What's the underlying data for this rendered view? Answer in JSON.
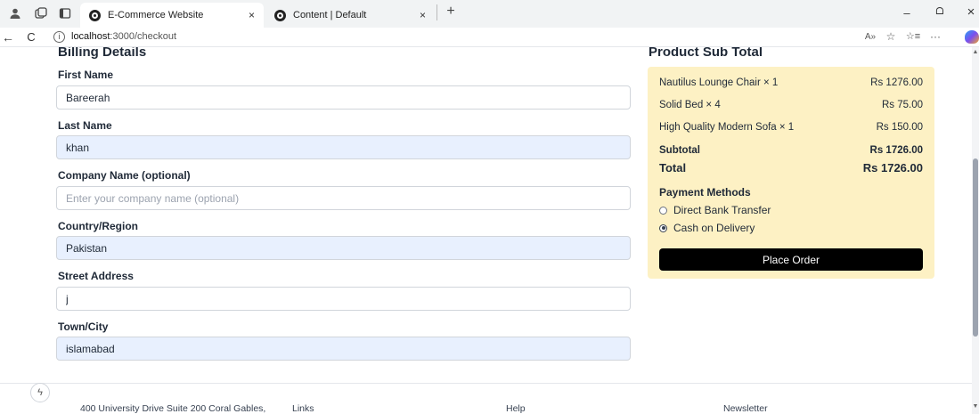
{
  "browser": {
    "tabs": [
      {
        "title": "E-Commerce Website",
        "active": true
      },
      {
        "title": "Content | Default",
        "active": false
      }
    ],
    "url_host": "localhost",
    "url_path": ":3000/checkout"
  },
  "billing": {
    "title": "Billing Details",
    "fields": [
      {
        "label": "First Name",
        "value": "Bareerah",
        "placeholder": ""
      },
      {
        "label": "Last Name",
        "value": "khan",
        "placeholder": ""
      },
      {
        "label": "Company Name (optional)",
        "value": "",
        "placeholder": "Enter your company name (optional)"
      },
      {
        "label": "Country/Region",
        "value": "Pakistan",
        "placeholder": ""
      },
      {
        "label": "Street Address",
        "value": "j",
        "placeholder": ""
      },
      {
        "label": "Town/City",
        "value": "islamabad",
        "placeholder": ""
      }
    ]
  },
  "summary": {
    "title": "Product Sub Total",
    "items": [
      {
        "name": "Nautilus Lounge Chair × 1",
        "price": "Rs 1276.00"
      },
      {
        "name": "Solid Bed × 4",
        "price": "Rs 75.00"
      },
      {
        "name": "High Quality Modern Sofa × 1",
        "price": "Rs 150.00"
      }
    ],
    "subtotal_label": "Subtotal",
    "subtotal_value": "Rs 1726.00",
    "total_label": "Total",
    "total_value": "Rs 1726.00",
    "payment_title": "Payment Methods",
    "payment_options": [
      {
        "label": "Direct Bank Transfer",
        "selected": false
      },
      {
        "label": "Cash on Delivery",
        "selected": true
      }
    ],
    "place_order_label": "Place Order"
  },
  "footer": {
    "address": "400 University Drive Suite 200 Coral Gables,",
    "links": "Links",
    "help": "Help",
    "newsletter": "Newsletter"
  },
  "icons": {
    "close": "×",
    "new_tab": "+",
    "back": "←",
    "reload": "C",
    "minimize": "–",
    "restore": "ᗝ",
    "window_close": "×",
    "read_aloud": "A»",
    "favorite": "☆",
    "favorites_list": "☆≡",
    "more": "···",
    "assist": "ϟ"
  },
  "colors": {
    "summary_bg": "#fdf1c4",
    "filled_field_bg": "#e8f0fe",
    "button_bg": "#000000"
  }
}
